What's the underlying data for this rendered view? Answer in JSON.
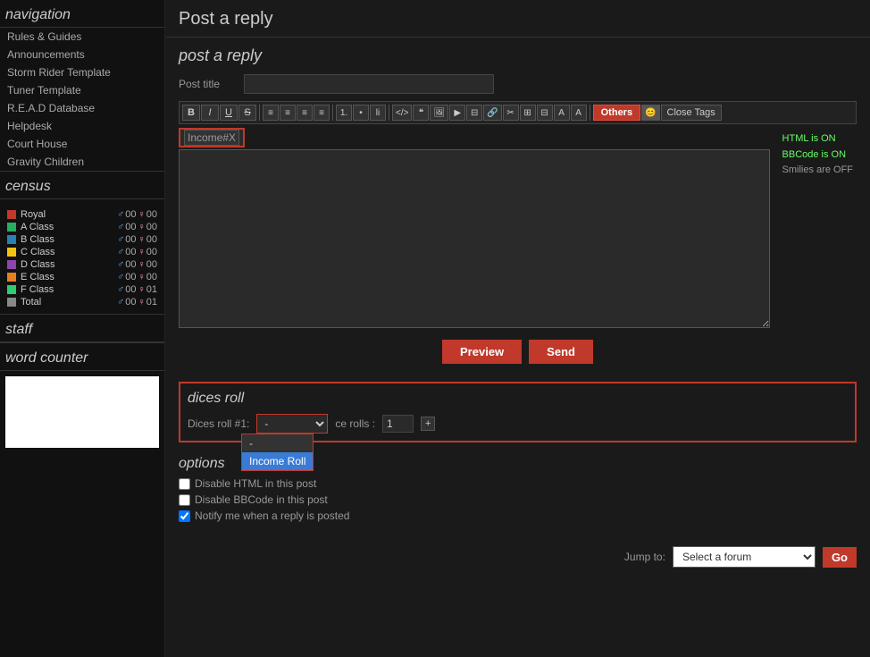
{
  "sidebar": {
    "navigation_title": "navigation",
    "nav_items": [
      {
        "label": "Rules & Guides"
      },
      {
        "label": "Announcements"
      },
      {
        "label": "Storm Rider Template"
      },
      {
        "label": "Tuner Template"
      },
      {
        "label": "R.E.A.D Database"
      },
      {
        "label": "Helpdesk"
      },
      {
        "label": "Court House"
      },
      {
        "label": "Gravity Children"
      }
    ],
    "census_title": "census",
    "census_rows": [
      {
        "label": "Royal",
        "color": "#c0392b",
        "male": "00",
        "female": "00"
      },
      {
        "label": "A Class",
        "color": "#27ae60",
        "male": "00",
        "female": "00"
      },
      {
        "label": "B Class",
        "color": "#2980b9",
        "male": "00",
        "female": "00"
      },
      {
        "label": "C Class",
        "color": "#f1c40f",
        "male": "00",
        "female": "00"
      },
      {
        "label": "D Class",
        "color": "#8e44ad",
        "male": "00",
        "female": "00"
      },
      {
        "label": "E Class",
        "color": "#e67e22",
        "male": "00",
        "female": "00"
      },
      {
        "label": "F Class",
        "color": "#2ecc71",
        "male": "00",
        "female": "01"
      },
      {
        "label": "Total",
        "color": "#888",
        "male": "00",
        "female": "01"
      }
    ],
    "staff_title": "staff",
    "word_counter_title": "word counter"
  },
  "main": {
    "page_title": "Post a reply",
    "form_title": "post a reply",
    "post_title_label": "Post title",
    "post_title_value": "",
    "toolbar_buttons": [
      {
        "label": "B",
        "style": "bold"
      },
      {
        "label": "I",
        "style": "italic"
      },
      {
        "label": "U",
        "style": "underline"
      },
      {
        "label": "S",
        "style": "strike"
      },
      {
        "label": "≡",
        "style": "align-left"
      },
      {
        "label": "≡",
        "style": "align-center"
      },
      {
        "label": "≡",
        "style": "align-right"
      },
      {
        "label": "≡",
        "style": "align-justify"
      },
      {
        "label": "≡",
        "style": "list-ol"
      },
      {
        "label": "≡",
        "style": "list-ul"
      },
      {
        "label": "li",
        "style": "list-item"
      },
      {
        "label": "⊙",
        "style": "code"
      },
      {
        "label": "◻",
        "style": "quote"
      },
      {
        "label": "▦",
        "style": "img"
      },
      {
        "label": "⊞",
        "style": "flash"
      },
      {
        "label": "⊟",
        "style": "media"
      },
      {
        "label": "◈",
        "style": "link"
      },
      {
        "label": "✂",
        "style": "cut"
      },
      {
        "label": "◫",
        "style": "table"
      },
      {
        "label": "◩",
        "style": "table2"
      },
      {
        "label": "✎",
        "style": "font"
      },
      {
        "label": "Α",
        "style": "special"
      }
    ],
    "others_btn": "Others",
    "close_tags_btn": "Close Tags",
    "income_tag": "Income#X",
    "editor_content": "",
    "html_status": "HTML is ON",
    "bbcode_status": "BBCode is ON",
    "smilies_status": "Smilies are OFF",
    "preview_btn": "Preview",
    "send_btn": "Send",
    "dices_title": "dices roll",
    "dices_roll_label": "Dices roll #1:",
    "dices_roll_placeholder": "-",
    "dice_rolls_label": "ce rolls :",
    "dice_rolls_value": "1",
    "dice_plus": "+",
    "dropdown_items": [
      {
        "label": "-",
        "selected": false
      },
      {
        "label": "Income Roll",
        "selected": true
      }
    ],
    "options_title": "options",
    "options": [
      {
        "label": "Disable HTML in this post",
        "checked": false
      },
      {
        "label": "Disable BBCode in this post",
        "checked": false
      },
      {
        "label": "Notify me when a reply is posted",
        "checked": true
      }
    ],
    "jump_to_label": "Jump to:",
    "jump_to_placeholder": "Select a forum",
    "go_btn": "Go"
  }
}
